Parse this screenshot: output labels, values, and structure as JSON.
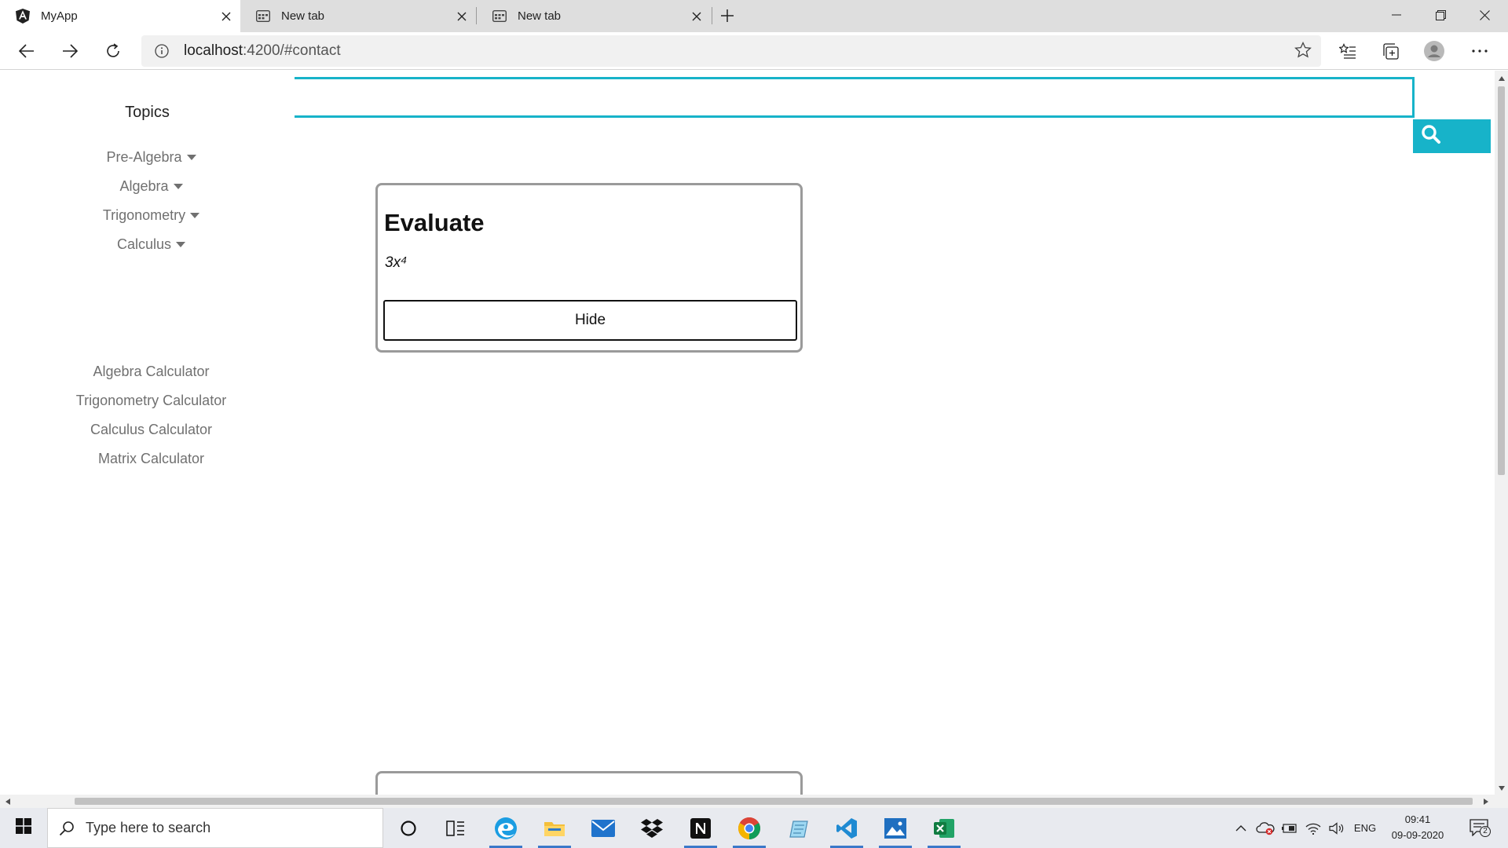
{
  "browser": {
    "tabs": [
      {
        "title": "MyApp",
        "active": true,
        "icon": "angular-icon"
      },
      {
        "title": "New tab",
        "active": false,
        "icon": "newtab-page-icon"
      },
      {
        "title": "New tab",
        "active": false,
        "icon": "newtab-page-icon"
      }
    ],
    "url_host": "localhost",
    "url_path": ":4200/#contact"
  },
  "sidebar": {
    "title": "Topics",
    "topics": [
      "Pre-Algebra",
      "Algebra",
      "Trigonometry",
      "Calculus"
    ],
    "calculators": [
      "Algebra Calculator",
      "Trigonometry Calculator",
      "Calculus Calculator",
      "Matrix Calculator"
    ]
  },
  "search": {
    "value": "",
    "placeholder": "",
    "icon": "search-icon"
  },
  "card": {
    "title": "Evaluate",
    "expression": "3x⁴",
    "hide_label": "Hide"
  },
  "taskbar": {
    "search_placeholder": "Type here to search",
    "language": "ENG",
    "time": "09:41",
    "date": "09-09-2020",
    "notifications": "2",
    "apps": [
      "cortana-icon",
      "task-view-icon",
      "edge-icon",
      "file-explorer-icon",
      "mail-icon",
      "dropbox-icon",
      "notion-icon",
      "chrome-icon",
      "notepad-icon",
      "vscode-icon",
      "photos-icon",
      "excel-icon"
    ]
  },
  "colors": {
    "accent": "#17b3c9",
    "sidebar_text": "#707070",
    "card_border": "#9a9a9a"
  }
}
